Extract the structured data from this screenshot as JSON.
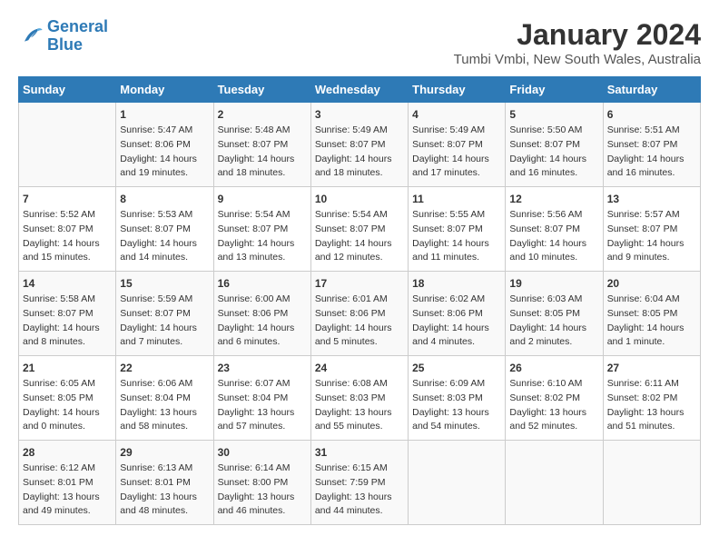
{
  "logo": {
    "text_general": "General",
    "text_blue": "Blue"
  },
  "title": "January 2024",
  "subtitle": "Tumbi Vmbi, New South Wales, Australia",
  "days_of_week": [
    "Sunday",
    "Monday",
    "Tuesday",
    "Wednesday",
    "Thursday",
    "Friday",
    "Saturday"
  ],
  "weeks": [
    [
      {
        "day": "",
        "sunrise": "",
        "sunset": "",
        "daylight": ""
      },
      {
        "day": "1",
        "sunrise": "Sunrise: 5:47 AM",
        "sunset": "Sunset: 8:06 PM",
        "daylight": "Daylight: 14 hours and 19 minutes."
      },
      {
        "day": "2",
        "sunrise": "Sunrise: 5:48 AM",
        "sunset": "Sunset: 8:07 PM",
        "daylight": "Daylight: 14 hours and 18 minutes."
      },
      {
        "day": "3",
        "sunrise": "Sunrise: 5:49 AM",
        "sunset": "Sunset: 8:07 PM",
        "daylight": "Daylight: 14 hours and 18 minutes."
      },
      {
        "day": "4",
        "sunrise": "Sunrise: 5:49 AM",
        "sunset": "Sunset: 8:07 PM",
        "daylight": "Daylight: 14 hours and 17 minutes."
      },
      {
        "day": "5",
        "sunrise": "Sunrise: 5:50 AM",
        "sunset": "Sunset: 8:07 PM",
        "daylight": "Daylight: 14 hours and 16 minutes."
      },
      {
        "day": "6",
        "sunrise": "Sunrise: 5:51 AM",
        "sunset": "Sunset: 8:07 PM",
        "daylight": "Daylight: 14 hours and 16 minutes."
      }
    ],
    [
      {
        "day": "7",
        "sunrise": "Sunrise: 5:52 AM",
        "sunset": "Sunset: 8:07 PM",
        "daylight": "Daylight: 14 hours and 15 minutes."
      },
      {
        "day": "8",
        "sunrise": "Sunrise: 5:53 AM",
        "sunset": "Sunset: 8:07 PM",
        "daylight": "Daylight: 14 hours and 14 minutes."
      },
      {
        "day": "9",
        "sunrise": "Sunrise: 5:54 AM",
        "sunset": "Sunset: 8:07 PM",
        "daylight": "Daylight: 14 hours and 13 minutes."
      },
      {
        "day": "10",
        "sunrise": "Sunrise: 5:54 AM",
        "sunset": "Sunset: 8:07 PM",
        "daylight": "Daylight: 14 hours and 12 minutes."
      },
      {
        "day": "11",
        "sunrise": "Sunrise: 5:55 AM",
        "sunset": "Sunset: 8:07 PM",
        "daylight": "Daylight: 14 hours and 11 minutes."
      },
      {
        "day": "12",
        "sunrise": "Sunrise: 5:56 AM",
        "sunset": "Sunset: 8:07 PM",
        "daylight": "Daylight: 14 hours and 10 minutes."
      },
      {
        "day": "13",
        "sunrise": "Sunrise: 5:57 AM",
        "sunset": "Sunset: 8:07 PM",
        "daylight": "Daylight: 14 hours and 9 minutes."
      }
    ],
    [
      {
        "day": "14",
        "sunrise": "Sunrise: 5:58 AM",
        "sunset": "Sunset: 8:07 PM",
        "daylight": "Daylight: 14 hours and 8 minutes."
      },
      {
        "day": "15",
        "sunrise": "Sunrise: 5:59 AM",
        "sunset": "Sunset: 8:07 PM",
        "daylight": "Daylight: 14 hours and 7 minutes."
      },
      {
        "day": "16",
        "sunrise": "Sunrise: 6:00 AM",
        "sunset": "Sunset: 8:06 PM",
        "daylight": "Daylight: 14 hours and 6 minutes."
      },
      {
        "day": "17",
        "sunrise": "Sunrise: 6:01 AM",
        "sunset": "Sunset: 8:06 PM",
        "daylight": "Daylight: 14 hours and 5 minutes."
      },
      {
        "day": "18",
        "sunrise": "Sunrise: 6:02 AM",
        "sunset": "Sunset: 8:06 PM",
        "daylight": "Daylight: 14 hours and 4 minutes."
      },
      {
        "day": "19",
        "sunrise": "Sunrise: 6:03 AM",
        "sunset": "Sunset: 8:05 PM",
        "daylight": "Daylight: 14 hours and 2 minutes."
      },
      {
        "day": "20",
        "sunrise": "Sunrise: 6:04 AM",
        "sunset": "Sunset: 8:05 PM",
        "daylight": "Daylight: 14 hours and 1 minute."
      }
    ],
    [
      {
        "day": "21",
        "sunrise": "Sunrise: 6:05 AM",
        "sunset": "Sunset: 8:05 PM",
        "daylight": "Daylight: 14 hours and 0 minutes."
      },
      {
        "day": "22",
        "sunrise": "Sunrise: 6:06 AM",
        "sunset": "Sunset: 8:04 PM",
        "daylight": "Daylight: 13 hours and 58 minutes."
      },
      {
        "day": "23",
        "sunrise": "Sunrise: 6:07 AM",
        "sunset": "Sunset: 8:04 PM",
        "daylight": "Daylight: 13 hours and 57 minutes."
      },
      {
        "day": "24",
        "sunrise": "Sunrise: 6:08 AM",
        "sunset": "Sunset: 8:03 PM",
        "daylight": "Daylight: 13 hours and 55 minutes."
      },
      {
        "day": "25",
        "sunrise": "Sunrise: 6:09 AM",
        "sunset": "Sunset: 8:03 PM",
        "daylight": "Daylight: 13 hours and 54 minutes."
      },
      {
        "day": "26",
        "sunrise": "Sunrise: 6:10 AM",
        "sunset": "Sunset: 8:02 PM",
        "daylight": "Daylight: 13 hours and 52 minutes."
      },
      {
        "day": "27",
        "sunrise": "Sunrise: 6:11 AM",
        "sunset": "Sunset: 8:02 PM",
        "daylight": "Daylight: 13 hours and 51 minutes."
      }
    ],
    [
      {
        "day": "28",
        "sunrise": "Sunrise: 6:12 AM",
        "sunset": "Sunset: 8:01 PM",
        "daylight": "Daylight: 13 hours and 49 minutes."
      },
      {
        "day": "29",
        "sunrise": "Sunrise: 6:13 AM",
        "sunset": "Sunset: 8:01 PM",
        "daylight": "Daylight: 13 hours and 48 minutes."
      },
      {
        "day": "30",
        "sunrise": "Sunrise: 6:14 AM",
        "sunset": "Sunset: 8:00 PM",
        "daylight": "Daylight: 13 hours and 46 minutes."
      },
      {
        "day": "31",
        "sunrise": "Sunrise: 6:15 AM",
        "sunset": "Sunset: 7:59 PM",
        "daylight": "Daylight: 13 hours and 44 minutes."
      },
      {
        "day": "",
        "sunrise": "",
        "sunset": "",
        "daylight": ""
      },
      {
        "day": "",
        "sunrise": "",
        "sunset": "",
        "daylight": ""
      },
      {
        "day": "",
        "sunrise": "",
        "sunset": "",
        "daylight": ""
      }
    ]
  ]
}
